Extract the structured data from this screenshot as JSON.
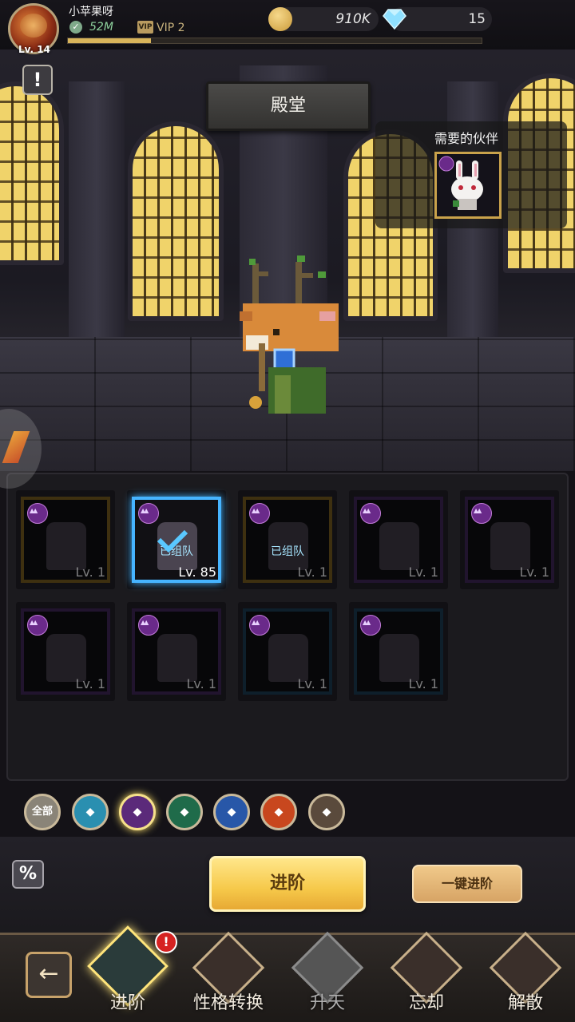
{
  "player": {
    "name": "小苹果呀",
    "level": "Lv. 14",
    "power": "52M",
    "vip": "VIP 2",
    "xp_progress": 0.2
  },
  "currency": {
    "coins": "910K",
    "gems": "15"
  },
  "scene": {
    "title": "殿堂",
    "alert_label": "!",
    "needed_title": "需要的伙伴"
  },
  "partners": [
    {
      "level": "Lv. 1",
      "rarity": "gold",
      "selected": false,
      "team_label": ""
    },
    {
      "level": "Lv. 85",
      "rarity": "blue",
      "selected": true,
      "team_label": "已组队"
    },
    {
      "level": "Lv. 1",
      "rarity": "gold",
      "selected": false,
      "team_label": "已组队"
    },
    {
      "level": "Lv. 1",
      "rarity": "purple",
      "selected": false,
      "team_label": ""
    },
    {
      "level": "Lv. 1",
      "rarity": "purple",
      "selected": false,
      "team_label": ""
    },
    {
      "level": "Lv. 1",
      "rarity": "purple",
      "selected": false,
      "team_label": ""
    },
    {
      "level": "Lv. 1",
      "rarity": "purple",
      "selected": false,
      "team_label": ""
    },
    {
      "level": "Lv. 1",
      "rarity": "blue",
      "selected": false,
      "team_label": ""
    },
    {
      "level": "Lv. 1",
      "rarity": "blue",
      "selected": false,
      "team_label": ""
    }
  ],
  "filters": [
    {
      "label": "全部",
      "icon": "all-icon",
      "color": "#8a8478",
      "active": false
    },
    {
      "label": "",
      "icon": "crown-faction-icon",
      "color": "#2a8fb0",
      "active": false
    },
    {
      "label": "",
      "icon": "spear-faction-icon",
      "color": "#5b2a7a",
      "active": true
    },
    {
      "label": "",
      "icon": "tree-faction-icon",
      "color": "#1f6b4a",
      "active": false
    },
    {
      "label": "",
      "icon": "anchor-faction-icon",
      "color": "#2857a8",
      "active": false
    },
    {
      "label": "",
      "icon": "dragon-faction-icon",
      "color": "#c8471e",
      "active": false
    },
    {
      "label": "",
      "icon": "eye-faction-icon",
      "color": "#5a4a3c",
      "active": false
    }
  ],
  "actions": {
    "percent_label": "%",
    "advance_label": "进阶",
    "one_key_label": "一键进阶"
  },
  "nav": {
    "back_label": "←",
    "badge": "!",
    "items": [
      {
        "label": "进阶",
        "icon": "advance-icon"
      },
      {
        "label": "性格转换",
        "icon": "personality-swap-icon"
      },
      {
        "label": "升天",
        "icon": "ascend-locked-icon"
      },
      {
        "label": "忘却",
        "icon": "forget-icon"
      },
      {
        "label": "解散",
        "icon": "dismiss-icon"
      }
    ]
  }
}
